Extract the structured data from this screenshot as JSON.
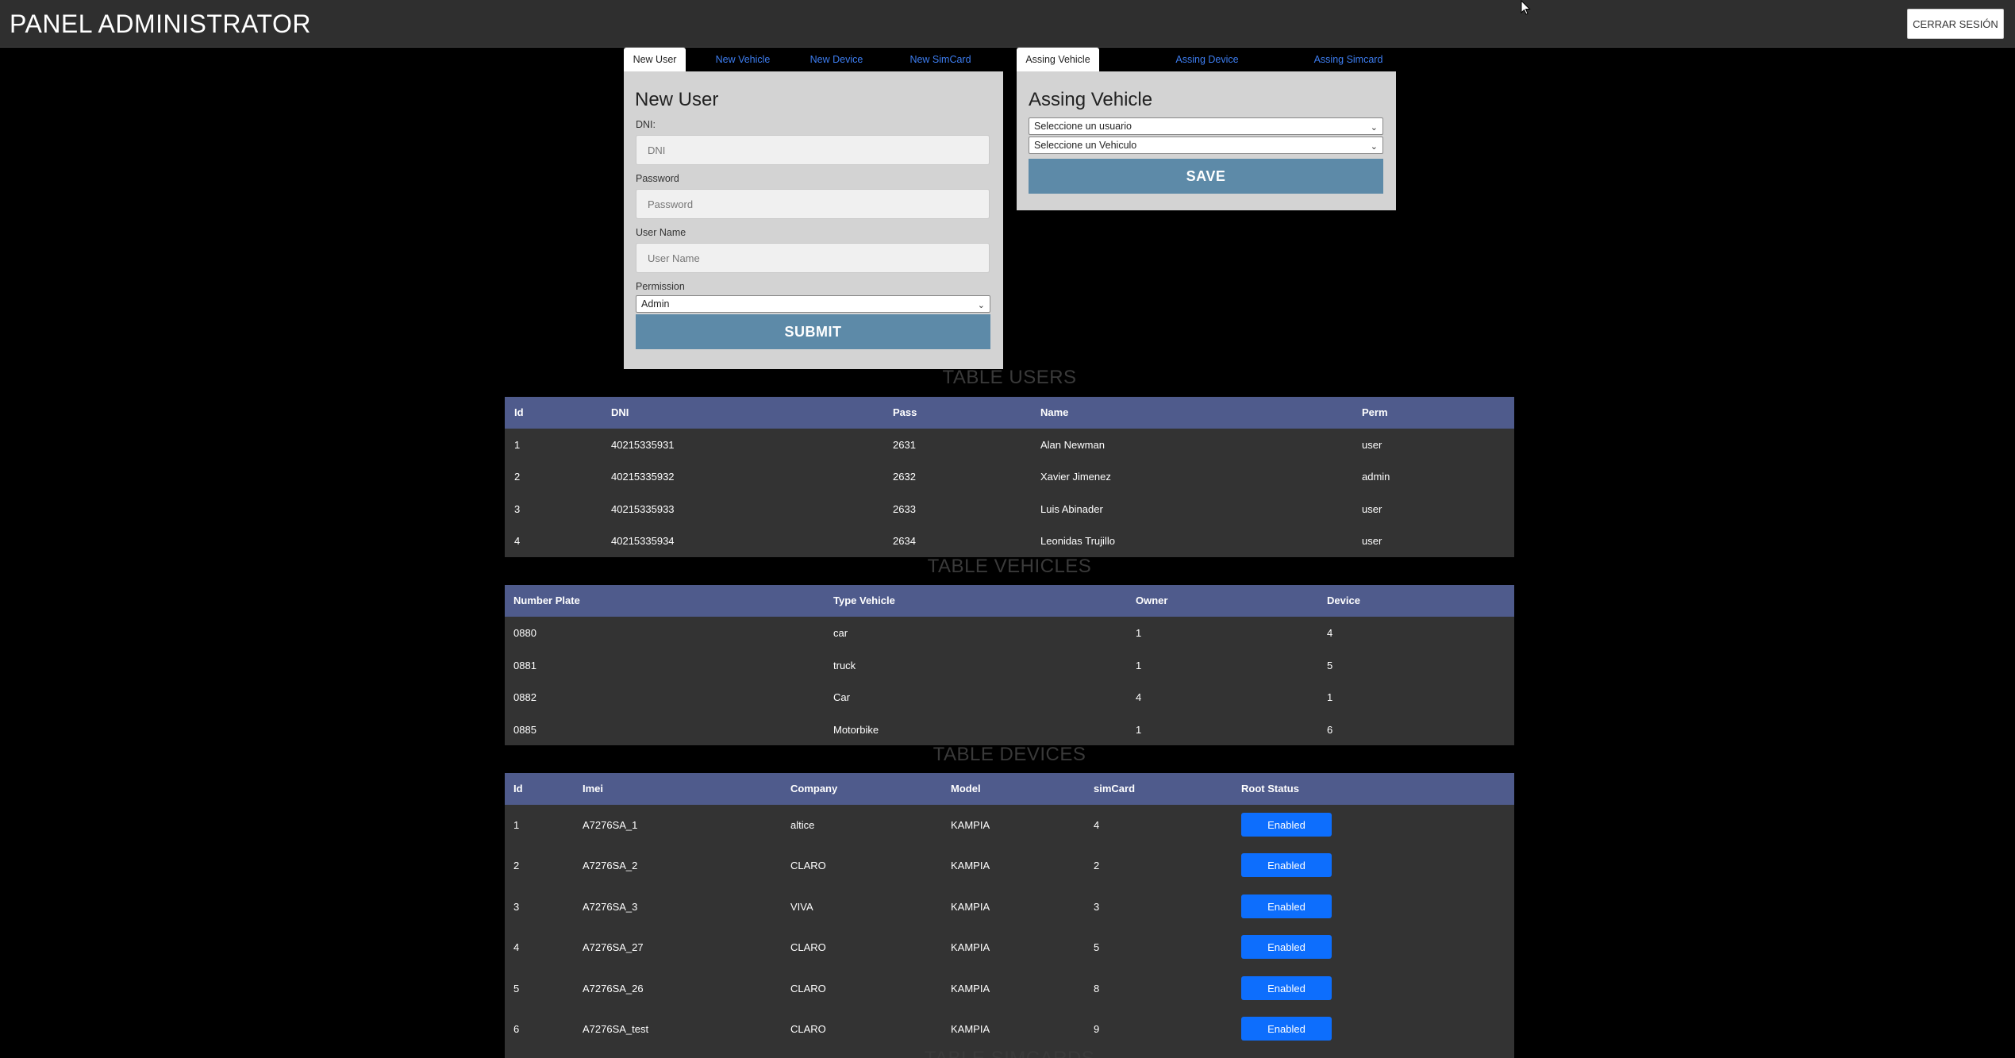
{
  "header": {
    "title": "PANEL ADMINISTRATOR",
    "logout_label": "CERRAR SESIÓN"
  },
  "left_panel": {
    "tabs": [
      {
        "label": "New User",
        "active": true
      },
      {
        "label": "New Vehicle",
        "active": false
      },
      {
        "label": "New Device",
        "active": false
      },
      {
        "label": "New SimCard",
        "active": false
      }
    ],
    "form_title": "New User",
    "fields": [
      {
        "label": "DNI:",
        "placeholder": "DNI"
      },
      {
        "label": "Password",
        "placeholder": "Password"
      },
      {
        "label": "User Name",
        "placeholder": "User Name"
      }
    ],
    "permission_label": "Permission",
    "permission_value": "Admin",
    "submit_label": "SUBMIT"
  },
  "right_panel": {
    "tabs": [
      {
        "label": "Assing Vehicle",
        "active": true
      },
      {
        "label": "Assing Device",
        "active": false
      },
      {
        "label": "Assing Simcard",
        "active": false
      }
    ],
    "form_title": "Assing Vehicle",
    "user_select": "Seleccione un usuario",
    "vehicle_select": "Seleccione un Vehiculo",
    "save_label": "SAVE"
  },
  "users_table": {
    "title": "TABLE USERS",
    "headers": [
      "Id",
      "DNI",
      "Pass",
      "Name",
      "Perm"
    ],
    "rows": [
      [
        "1",
        "40215335931",
        "2631",
        "Alan Newman",
        "user"
      ],
      [
        "2",
        "40215335932",
        "2632",
        "Xavier Jimenez",
        "admin"
      ],
      [
        "3",
        "40215335933",
        "2633",
        "Luis Abinader",
        "user"
      ],
      [
        "4",
        "40215335934",
        "2634",
        "Leonidas Trujillo",
        "user"
      ]
    ]
  },
  "vehicles_table": {
    "title": "TABLE VEHICLES",
    "headers": [
      "Number Plate",
      "Type Vehicle",
      "Owner",
      "Device"
    ],
    "rows": [
      [
        "0880",
        "car",
        "1",
        "4"
      ],
      [
        "0881",
        "truck",
        "1",
        "5"
      ],
      [
        "0882",
        "Car",
        "4",
        "1"
      ],
      [
        "0885",
        "Motorbike",
        "1",
        "6"
      ]
    ]
  },
  "devices_table": {
    "title": "TABLE DEVICES",
    "headers": [
      "Id",
      "Imei",
      "Company",
      "Model",
      "simCard",
      "Root Status"
    ],
    "rows": [
      [
        "1",
        "A7276SA_1",
        "altice",
        "KAMPIA",
        "4",
        "Enabled"
      ],
      [
        "2",
        "A7276SA_2",
        "CLARO",
        "KAMPIA",
        "2",
        "Enabled"
      ],
      [
        "3",
        "A7276SA_3",
        "VIVA",
        "KAMPIA",
        "3",
        "Enabled"
      ],
      [
        "4",
        "A7276SA_27",
        "CLARO",
        "KAMPIA",
        "5",
        "Enabled"
      ],
      [
        "5",
        "A7276SA_26",
        "CLARO",
        "KAMPIA",
        "8",
        "Enabled"
      ],
      [
        "6",
        "A7276SA_test",
        "CLARO",
        "KAMPIA",
        "9",
        "Enabled"
      ]
    ]
  },
  "simcards_table": {
    "title": "TABLE SIMCARDS"
  }
}
